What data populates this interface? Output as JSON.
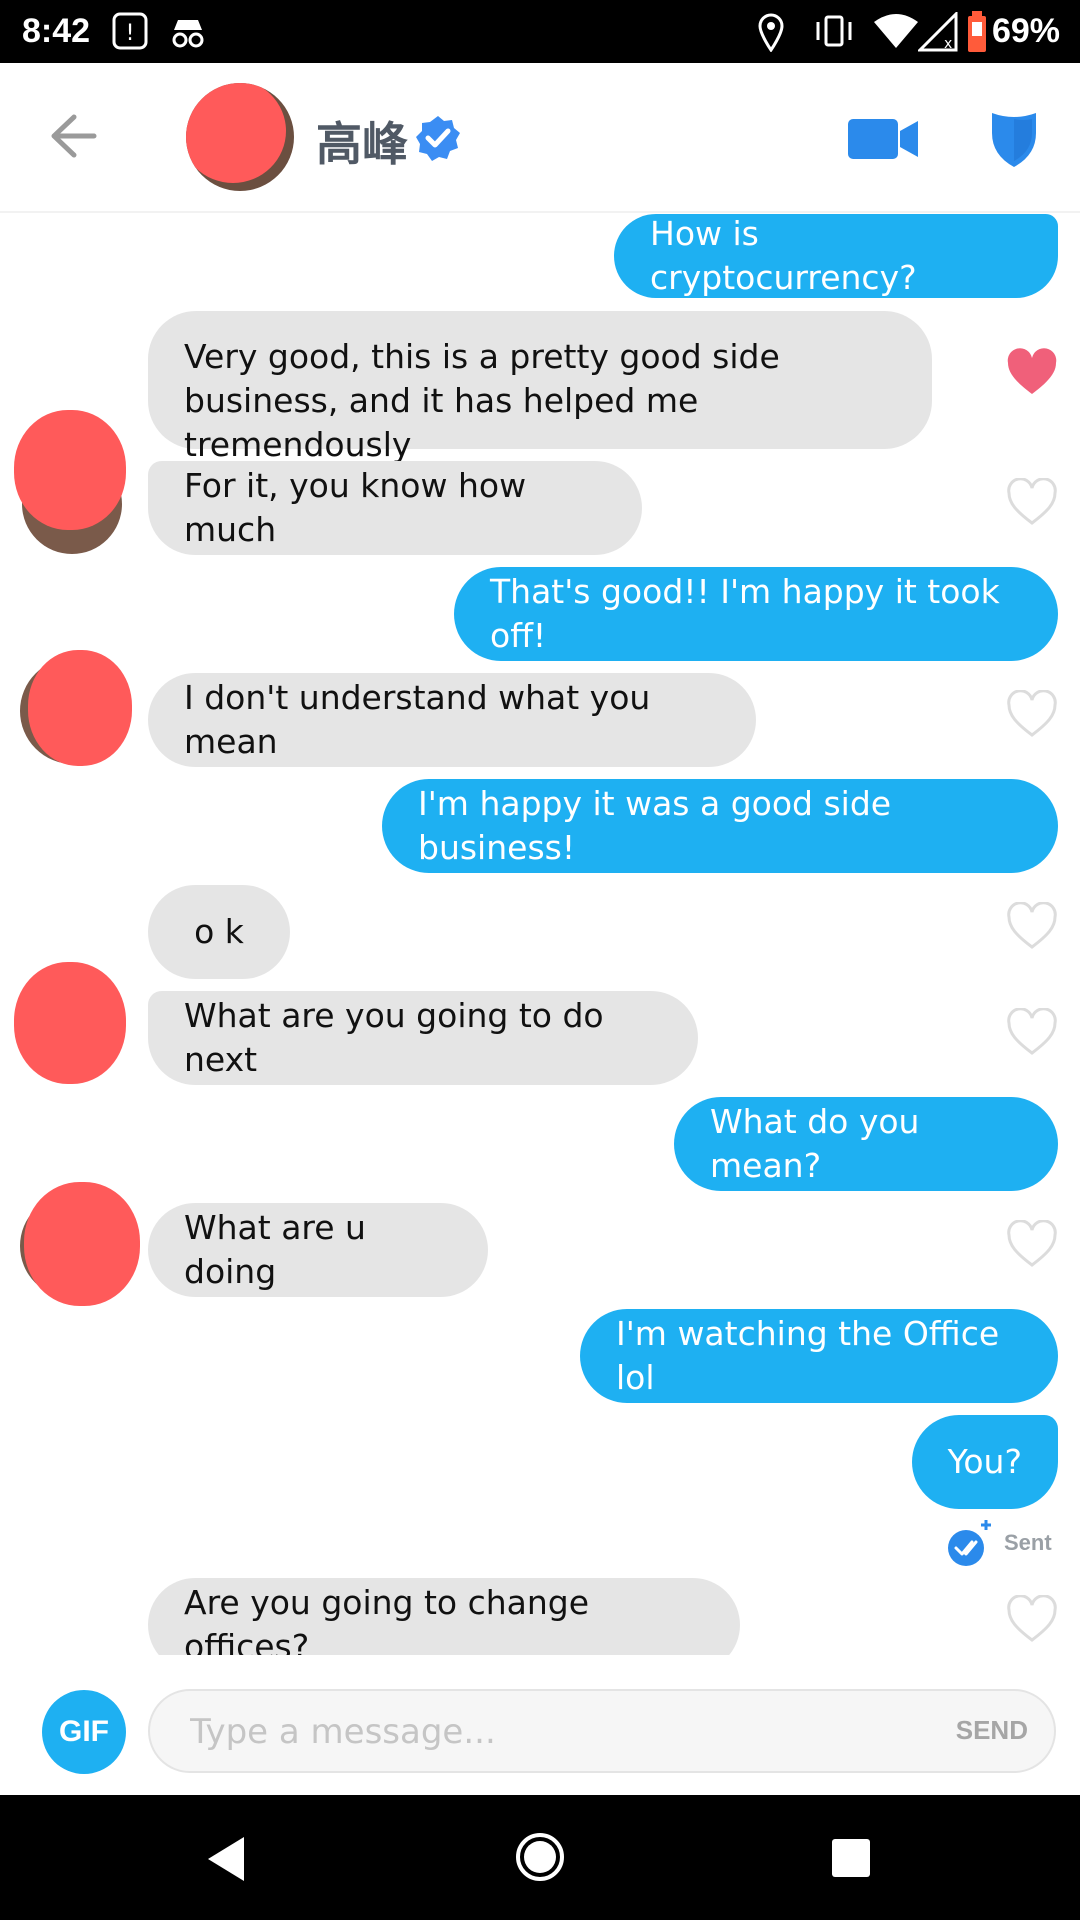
{
  "status_bar": {
    "time": "8:42",
    "battery_pct": "69%"
  },
  "header": {
    "contact_name": "高峰"
  },
  "messages": [
    {
      "from": "me",
      "text": "How is cryptocurrency?"
    },
    {
      "from": "them",
      "lines": [
        "Very good, this is a pretty good side",
        "business, and it has helped me tremendously"
      ],
      "liked": true
    },
    {
      "from": "them",
      "text": "For it, you know how much"
    },
    {
      "from": "me",
      "text": "That's good!! I'm happy it took off!"
    },
    {
      "from": "them",
      "text": "I don't understand what you mean"
    },
    {
      "from": "me",
      "text": "I'm happy it was a good side business!"
    },
    {
      "from": "them",
      "text": "o k"
    },
    {
      "from": "them",
      "text": "What are you going to do next"
    },
    {
      "from": "me",
      "text": "What do you mean?"
    },
    {
      "from": "them",
      "text": "What are u doing"
    },
    {
      "from": "me",
      "text": "I'm watching the Office lol"
    },
    {
      "from": "me",
      "text": "You?"
    },
    {
      "from": "them",
      "text": "Are you going to change offices?"
    }
  ],
  "sent_status": "Sent",
  "composer": {
    "gif_label": "GIF",
    "placeholder": "Type a message...",
    "send_label": "SEND"
  },
  "colors": {
    "accent": "#1eb0f2",
    "incoming_bubble": "#e5e5e5",
    "heart_liked": "#f0607a",
    "verified": "#3b8df3"
  },
  "icons": [
    "back-arrow-icon",
    "verified-badge-icon",
    "video-call-icon",
    "shield-icon",
    "heart-icon",
    "read-receipt-icon",
    "nav-back-icon",
    "nav-home-icon",
    "nav-recents-icon"
  ]
}
